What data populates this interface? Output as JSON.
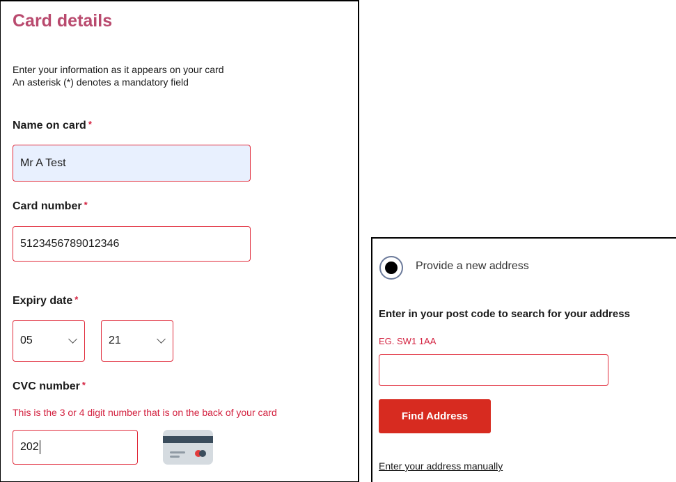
{
  "card_details": {
    "title": "Card details",
    "intro_line1": "Enter your information as it appears on your card",
    "intro_line2": "An asterisk (*) denotes a mandatory field",
    "required_mark": "*",
    "name_on_card": {
      "label": "Name on card",
      "value": "Mr A Test"
    },
    "card_number": {
      "label": "Card number",
      "value": "5123456789012346"
    },
    "expiry_date": {
      "label": "Expiry date",
      "month": "05",
      "year": "21"
    },
    "cvc": {
      "label": "CVC number",
      "hint": "This is the 3 or 4 digit number that is on the back of your card",
      "value": "202",
      "icon": "card-back-icon"
    }
  },
  "address": {
    "radio_label": "Provide a new address",
    "radio_selected": true,
    "postcode_prompt": "Enter in your post code to search for your address",
    "postcode_example": "EG. SW1 1AA",
    "postcode_value": "",
    "find_button": "Find Address",
    "manual_link": "Enter your address manually"
  },
  "colors": {
    "title": "#b94a6e",
    "error_border": "#e02a3a",
    "hint_red": "#d3213f",
    "button_red": "#d72b20",
    "autofill_bg": "#e8f0fe"
  }
}
